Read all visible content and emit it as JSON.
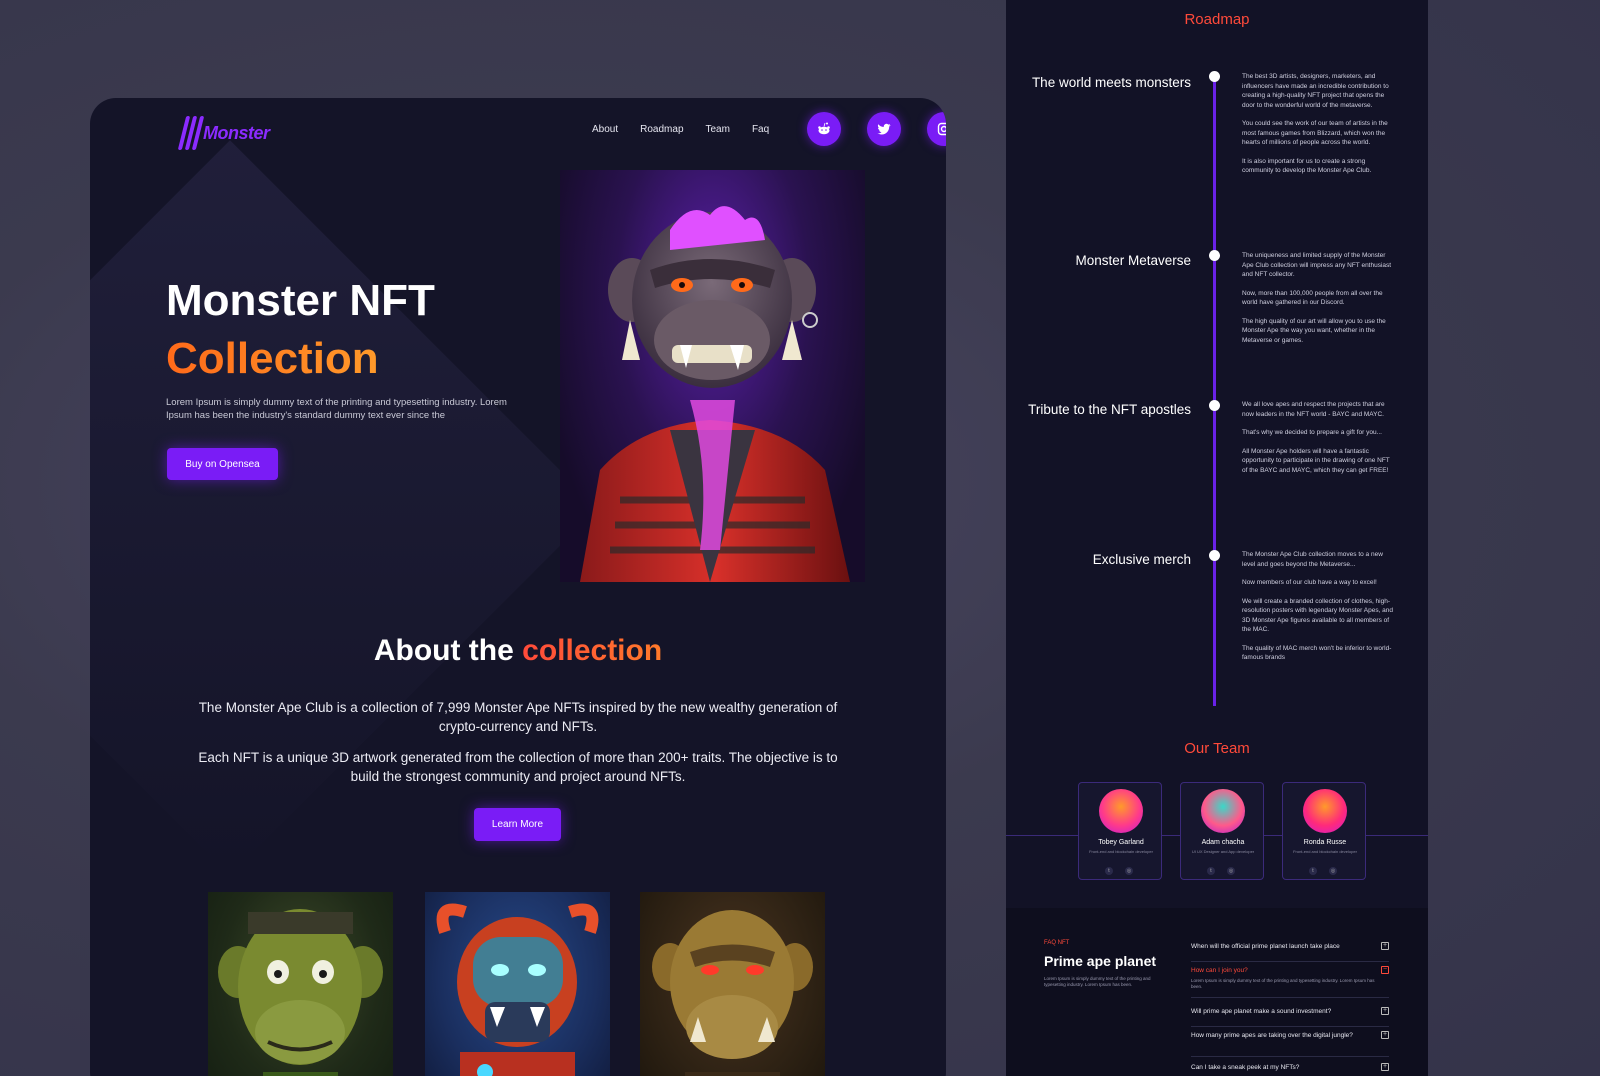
{
  "nav": {
    "logo_text": "Monster",
    "links": [
      "About",
      "Roadmap",
      "Team",
      "Faq"
    ],
    "socials": [
      "reddit-icon",
      "twitter-icon",
      "instagram-icon"
    ]
  },
  "hero": {
    "title_line1": "Monster NFT",
    "title_line2": "Collection",
    "description": "Lorem Ipsum is simply dummy text of the printing and typesetting industry. Lorem Ipsum has been the industry's standard dummy text ever since the",
    "cta": "Buy on Opensea"
  },
  "about": {
    "title_plain": "About the",
    "title_accent": "collection",
    "paragraph1": "The Monster Ape Club is a collection of 7,999 Monster Ape NFTs inspired by the new wealthy generation of crypto-currency and NFTs.",
    "paragraph2": "Each NFT is a unique 3D artwork generated from the collection of more than 200+ traits. The objective is to build the strongest community and project around NFTs.",
    "cta": "Learn More"
  },
  "roadmap": {
    "heading": "Roadmap",
    "items": [
      {
        "title": "The world meets monsters",
        "paragraphs": [
          "The best 3D artists, designers, marketers, and influencers have made an incredible contribution to creating a high-quality NFT project that opens the door to the wonderful world of the metaverse.",
          "You could see the work of our team of artists in the most famous games from Blizzard, which won the hearts of millions of people across the world.",
          "It is also important for us to create a strong community to develop the Monster Ape Club."
        ]
      },
      {
        "title": "Monster Metaverse",
        "paragraphs": [
          "The uniqueness and limited supply of the Monster Ape Club collection will impress any NFT enthusiast and NFT collector.",
          "Now, more than 100,000 people from all over the world have gathered in our Discord.",
          "The high quality of our art will allow you to use the Monster Ape the way you want, whether in the Metaverse or games."
        ]
      },
      {
        "title": "Tribute to the NFT apostles",
        "paragraphs": [
          "We all love apes and respect the projects that are now leaders in the NFT world - BAYC and MAYC.",
          "That's why we decided to prepare a gift for you...",
          "All Monster Ape holders will have a fantastic opportunity to participate in the drawing of one NFT of the BAYC and MAYC, which they can get FREE!"
        ]
      },
      {
        "title": "Exclusive merch",
        "paragraphs": [
          "The Monster Ape Club collection moves to a new level and goes beyond the Metaverse...",
          "Now members of our club have a way to excel!",
          "We will create a branded collection of clothes, high-resolution posters with legendary Monster Apes, and 3D Monster Ape figures available to all members of the MAC.",
          "The quality of MAC merch won't be inferior to world-famous brands"
        ]
      }
    ]
  },
  "team": {
    "heading": "Our Team",
    "members": [
      {
        "name": "Tobey Garland",
        "role": "Front-end and blockchain developer"
      },
      {
        "name": "Adam chacha",
        "role": "UI UX Designer and App developer"
      },
      {
        "name": "Ronda Russe",
        "role": "Front-end and blockchain developer"
      }
    ]
  },
  "faq": {
    "eyebrow": "FAQ NFT",
    "title": "Prime ape planet",
    "description": "Lorem Ipsum is simply dummy text of the printing and typesetting industry. Lorem Ipsum has been.",
    "items": [
      {
        "q": "When will the official prime planet launch take place",
        "a": "",
        "active": false
      },
      {
        "q": "How can I join you?",
        "a": "Lorem Ipsum is simply dummy text of the printing and typesetting industry. Lorem Ipsum has been.",
        "active": true
      },
      {
        "q": "Will prime ape planet make a sound investment?",
        "a": "",
        "active": false
      },
      {
        "q": "How many prime apes are taking over the digital jungle?",
        "a": "",
        "active": false
      },
      {
        "q": "Can I take a sneak peek at my NFTs?",
        "a": "",
        "active": false
      }
    ]
  },
  "colors": {
    "accent_purple": "#7a1cf6",
    "accent_orange": "#ff7a1a",
    "accent_red": "#ff4a3a",
    "card_bg": "#141428"
  }
}
